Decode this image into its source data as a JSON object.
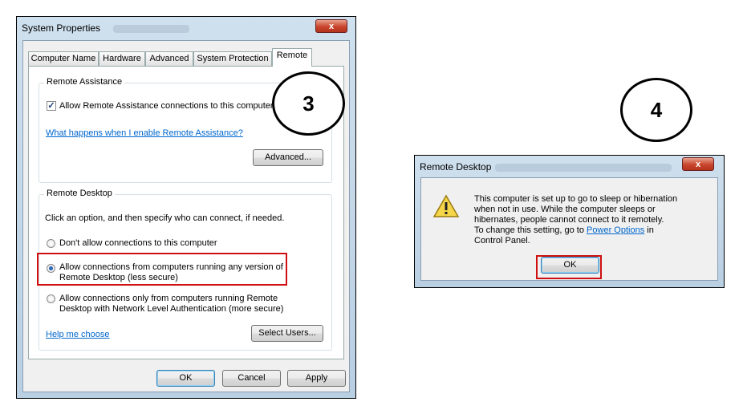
{
  "system_properties": {
    "title": "System Properties",
    "close_label": "x",
    "tabs": [
      {
        "label": "Computer Name"
      },
      {
        "label": "Hardware"
      },
      {
        "label": "Advanced"
      },
      {
        "label": "System Protection"
      },
      {
        "label": "Remote"
      }
    ],
    "remote_assistance": {
      "group_label": "Remote Assistance",
      "checkbox_label": "Allow Remote Assistance connections to this computer",
      "checked": true,
      "help_link": "What happens when I enable Remote Assistance?",
      "advanced_button": "Advanced..."
    },
    "remote_desktop": {
      "group_label": "Remote Desktop",
      "instruction": "Click an option, and then specify who can connect, if needed.",
      "options": [
        {
          "label": "Don't allow connections to this computer"
        },
        {
          "line1": "Allow connections from computers running any version of",
          "line2": "Remote Desktop (less secure)"
        },
        {
          "line1": "Allow connections only from computers running Remote",
          "line2": "Desktop with Network Level Authentication (more secure)"
        }
      ],
      "selected_option": 1,
      "help_link": "Help me choose",
      "select_users_button": "Select Users..."
    },
    "buttons": {
      "ok": "OK",
      "cancel": "Cancel",
      "apply": "Apply"
    }
  },
  "remote_desktop_dialog": {
    "title": "Remote Desktop",
    "close_label": "x",
    "message_lines": [
      "This computer is set up to go to sleep or hibernation",
      "when not in use. While the computer sleeps or",
      "hibernates, people cannot connect to it remotely."
    ],
    "message_prefix": "To change this setting, go to ",
    "power_options_link": "Power Options",
    "message_suffix": " in",
    "message_last": "Control Panel.",
    "ok_button": "OK",
    "warning_icon": "warning-icon"
  },
  "step_markers": [
    "3",
    "4"
  ]
}
